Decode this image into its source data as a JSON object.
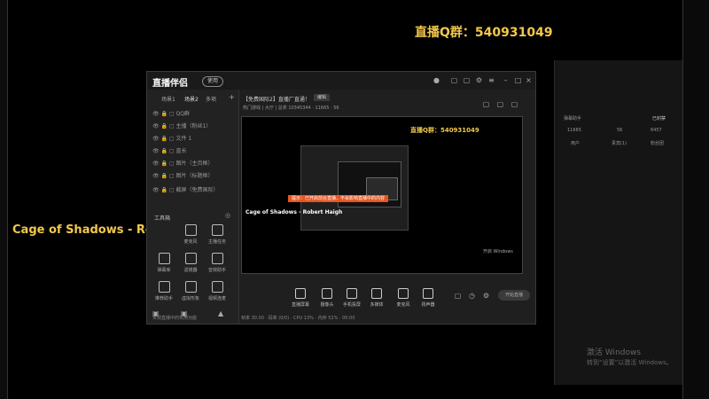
{
  "overlay": {
    "stream_group": "直播Q群：540931049",
    "song": "Cage of Shadows - Robert Haigh"
  },
  "app": {
    "logo": "直播伴侣",
    "badge": "使用",
    "room_title": "【免费国际2】直播厂直通！",
    "edit_label": "编辑",
    "stats": "热门游戏 | 大厅 | 总奖 10345344 · 11665 · 56",
    "scene_tabs": [
      "场景1",
      "场景2",
      "多项"
    ],
    "sources": [
      "QQ群",
      "主播（粉丝1）",
      "文件 1",
      "直长",
      "图片（主页框）",
      "图片（标题框）",
      "截屏（免费国际）"
    ],
    "tools_title": "工具箱",
    "tools": [
      "麦克风",
      "主播任务",
      "弹幕库",
      "滤镜器",
      "音效助手",
      "推荐助手",
      "虚拟形象",
      "视频连麦"
    ],
    "footer_tip": "实现直播中的实用功能",
    "bottom_tools": [
      "直播屏幕",
      "摄像头",
      "手机投屏",
      "多媒体",
      "麦克风",
      "扬声器"
    ],
    "start_label": "开始直播",
    "status": "帧率 30.00 · 码率 (0/0) · CPU 13% · 内存 52% · 00:00"
  },
  "preview": {
    "group": "直播Q群：540931049",
    "song": "Cage of Shadows - Robert Haigh",
    "toast": "提示：已开启前台直播，不会影响直播中的内容",
    "note": "开启 Windows"
  },
  "right_panel": {
    "header": "弹幕助手",
    "status": "已封禁",
    "stats": [
      "11665",
      "56",
      "6457"
    ],
    "cols": [
      "用户",
      "贵宾(1)",
      "粉丝团"
    ]
  },
  "watermark": {
    "line1": "激活 Windows",
    "line2": "转到“设置”以激活 Windows。"
  },
  "colors": {
    "accent_gold": "#f3c84b",
    "toast_orange": "#e8541f"
  }
}
